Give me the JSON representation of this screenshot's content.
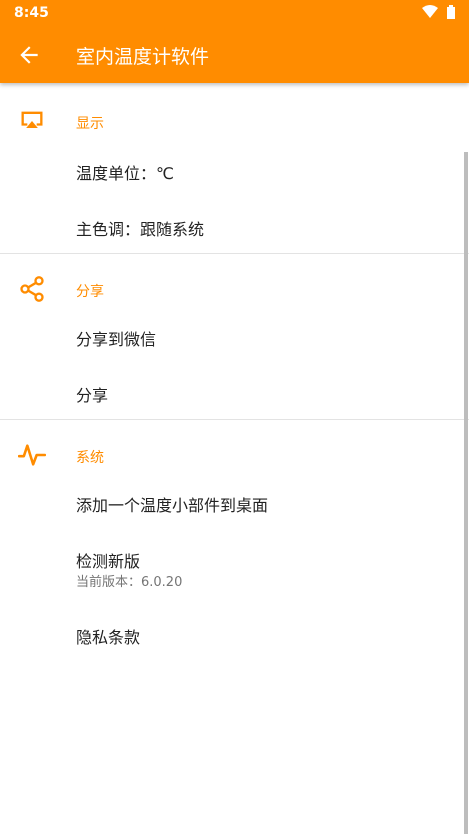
{
  "status_bar": {
    "time": "8:45"
  },
  "app_bar": {
    "title": "室内温度计软件"
  },
  "sections": {
    "display": {
      "title": "显示",
      "items": [
        "温度单位：℃",
        "主色调：跟随系统"
      ]
    },
    "share": {
      "title": "分享",
      "items": [
        "分享到微信",
        "分享"
      ]
    },
    "system": {
      "title": "系统",
      "items": [
        "添加一个温度小部件到桌面",
        "检测新版",
        "隐私条款"
      ],
      "version_summary": "当前版本：6.0.20"
    }
  },
  "colors": {
    "accent": "#FF8C00",
    "divider": "#e3e3e3",
    "text": "#222222"
  },
  "icons": {
    "display": "cast-screen-icon",
    "share": "share-icon",
    "system": "pulse-icon",
    "back": "back-arrow-icon"
  }
}
